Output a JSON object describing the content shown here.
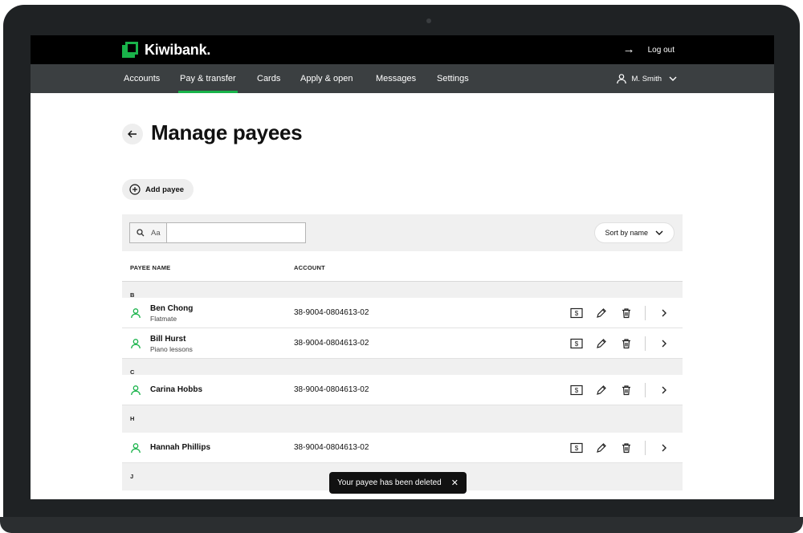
{
  "brand": {
    "name": "Kiwibank.",
    "accent": "#19b34a"
  },
  "topbar": {
    "logout_label": "Log out"
  },
  "nav": {
    "items": [
      {
        "label": "Accounts",
        "active": false
      },
      {
        "label": "Pay & transfer",
        "active": true
      },
      {
        "label": "Cards",
        "active": false
      },
      {
        "label": "Apply & open",
        "active": false
      },
      {
        "label": "Messages",
        "active": false
      },
      {
        "label": "Settings",
        "active": false
      }
    ],
    "user_name": "M. Smith"
  },
  "page": {
    "title": "Manage payees",
    "add_payee_label": "Add payee"
  },
  "search": {
    "prefix": "Aa",
    "value": ""
  },
  "sort": {
    "label": "Sort by name"
  },
  "columns": {
    "payee_name": "PAYEE NAME",
    "account": "ACCOUNT"
  },
  "groups": [
    {
      "letter": "B",
      "payees": [
        {
          "name": "Ben Chong",
          "description": "Flatmate",
          "account": "38-9004-0804613-02"
        },
        {
          "name": "Bill Hurst",
          "description": "Piano lessons",
          "account": "38-9004-0804613-02"
        }
      ]
    },
    {
      "letter": "C",
      "payees": [
        {
          "name": "Carina Hobbs",
          "description": "",
          "account": "38-9004-0804613-02"
        }
      ]
    },
    {
      "letter": "H",
      "payees": [
        {
          "name": "Hannah Phillips",
          "description": "",
          "account": "38-9004-0804613-02"
        }
      ]
    },
    {
      "letter": "J",
      "payees": []
    }
  ],
  "toast": {
    "message": "Your payee has been deleted"
  }
}
